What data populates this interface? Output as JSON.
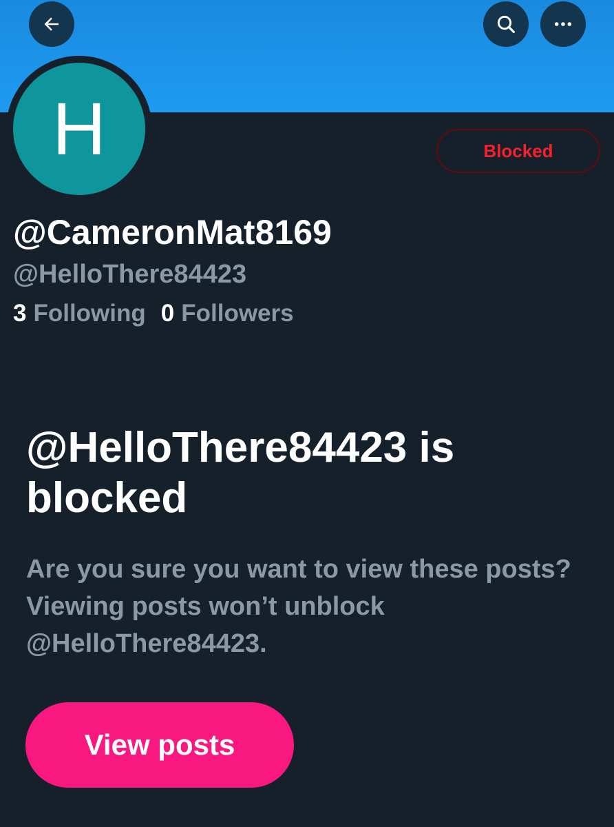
{
  "header": {
    "back_icon": "arrow-left-icon",
    "search_icon": "search-icon",
    "more_icon": "more-horizontal-icon",
    "banner_color": "#1d9bf0"
  },
  "profile": {
    "avatar_letter": "H",
    "avatar_color": "#0f969c",
    "blocked_label": "Blocked",
    "display_name": "@CameronMat8169",
    "handle": "@HelloThere84423",
    "following_count": "3",
    "following_label": "Following",
    "followers_count": "0",
    "followers_label": "Followers"
  },
  "blocked_notice": {
    "title": "@HelloThere84423 is blocked",
    "description": "Are you sure you want to view these posts? Viewing posts won’t unblock @HelloThere84423.",
    "view_posts_label": "View posts",
    "button_color": "#f91880",
    "blocked_color": "#f4212e"
  }
}
